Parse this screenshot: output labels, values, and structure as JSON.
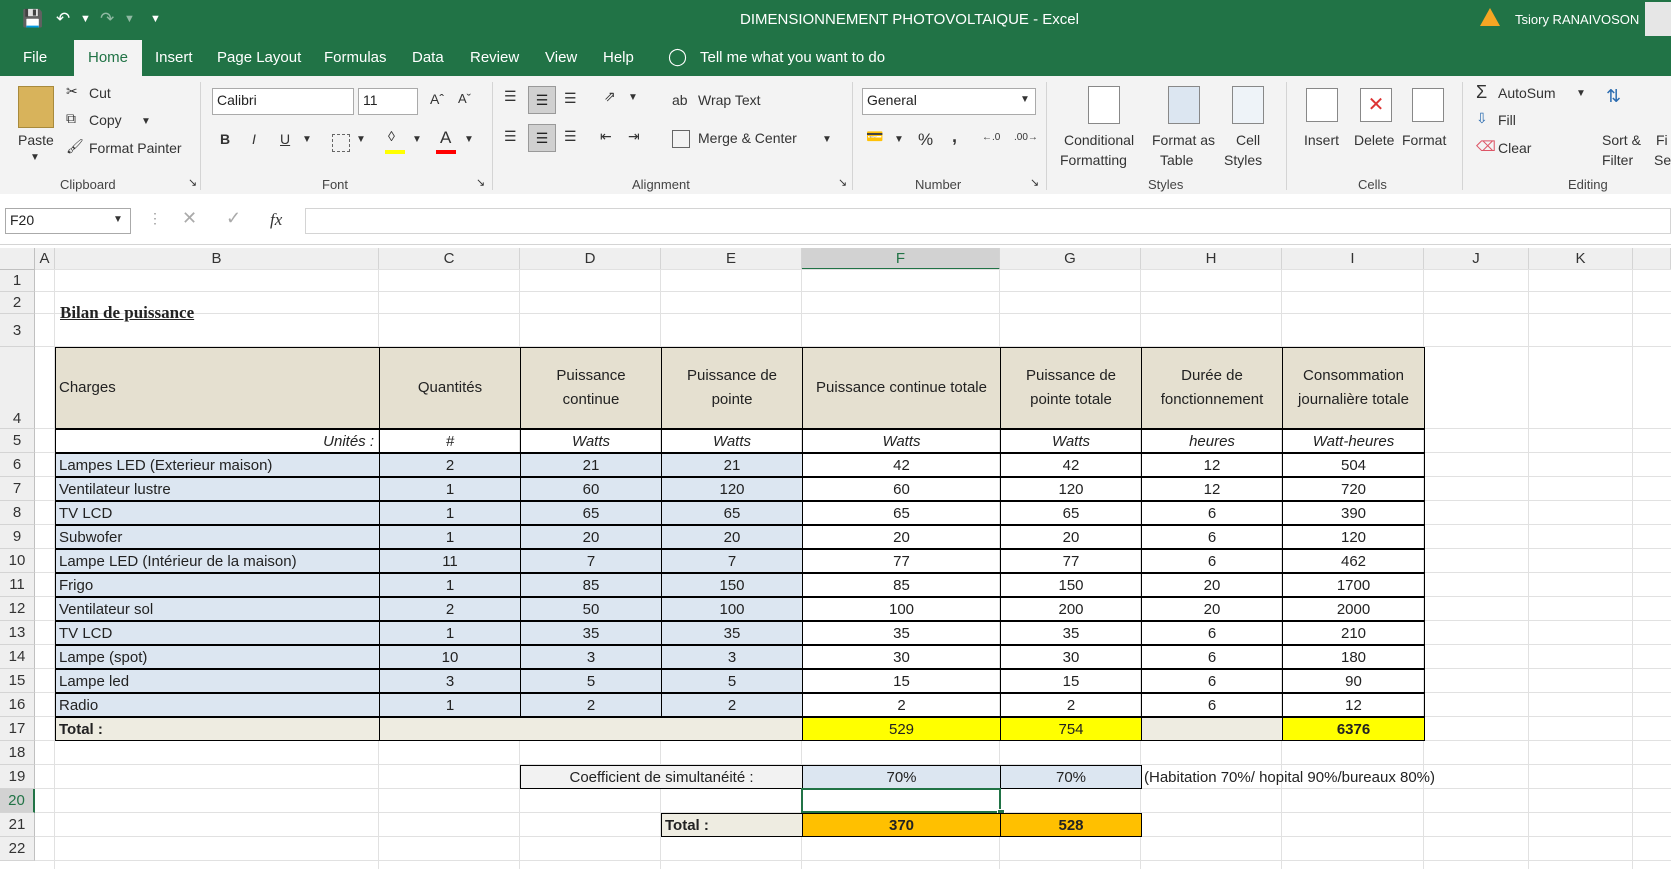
{
  "window": {
    "title": "DIMENSIONNEMENT PHOTOVOLTAIQUE  -  Excel",
    "user": "Tsiory RANAIVOSON"
  },
  "tabs": [
    "File",
    "Home",
    "Insert",
    "Page Layout",
    "Formulas",
    "Data",
    "Review",
    "View",
    "Help"
  ],
  "tell_me": "Tell me what you want to do",
  "ribbon": {
    "clipboard": {
      "paste": "Paste",
      "cut": "Cut",
      "copy": "Copy",
      "format_painter": "Format Painter",
      "label": "Clipboard"
    },
    "font": {
      "name": "Calibri",
      "size": "11",
      "label": "Font",
      "bold": "B",
      "italic": "I",
      "underline": "U"
    },
    "alignment": {
      "wrap": "Wrap Text",
      "merge": "Merge & Center",
      "label": "Alignment"
    },
    "number": {
      "format": "General",
      "label": "Number",
      "percent": "%",
      "comma": ","
    },
    "styles": {
      "conditional": "Conditional",
      "conditional2": "Formatting",
      "format_table": "Format as",
      "format_table2": "Table",
      "cell_styles": "Cell",
      "cell_styles2": "Styles",
      "label": "Styles"
    },
    "cells": {
      "insert": "Insert",
      "delete": "Delete",
      "format": "Format",
      "label": "Cells"
    },
    "editing": {
      "autosum": "AutoSum",
      "fill": "Fill",
      "clear": "Clear",
      "sort": "Sort &",
      "sort2": "Filter",
      "find": "Fi",
      "find2": "Sel",
      "label": "Editing"
    }
  },
  "formula_bar": {
    "name_box": "F20",
    "fx": "fx",
    "value": ""
  },
  "columns": [
    "A",
    "B",
    "C",
    "D",
    "E",
    "F",
    "G",
    "H",
    "I",
    "J",
    "K"
  ],
  "rows": [
    "1",
    "2",
    "3",
    "4",
    "5",
    "6",
    "7",
    "8",
    "9",
    "10",
    "11",
    "12",
    "13",
    "14",
    "15",
    "16",
    "17",
    "18",
    "19",
    "20",
    "21",
    "22"
  ],
  "sheet": {
    "title": "Bilan de puissance",
    "headers": {
      "b": "Charges",
      "c": "Quantités",
      "d": "Puissance continue",
      "e": "Puissance de pointe",
      "f": "Puissance continue totale",
      "g": "Puissance de pointe  totale",
      "h": "Durée de fonctionnement",
      "i": "Consommation journalière totale"
    },
    "units": {
      "b": "Unités :",
      "c": "#",
      "d": "Watts",
      "e": "Watts",
      "f": "Watts",
      "g": "Watts",
      "h": "heures",
      "i": "Watt-heures"
    },
    "items": [
      {
        "name": "Lampes LED (Exterieur maison)",
        "qty": "2",
        "pc": "21",
        "pp": "21",
        "pct": "42",
        "ppt": "42",
        "dur": "12",
        "cons": "504"
      },
      {
        "name": "Ventilateur lustre",
        "qty": "1",
        "pc": "60",
        "pp": "120",
        "pct": "60",
        "ppt": "120",
        "dur": "12",
        "cons": "720"
      },
      {
        "name": "TV LCD",
        "qty": "1",
        "pc": "65",
        "pp": "65",
        "pct": "65",
        "ppt": "65",
        "dur": "6",
        "cons": "390"
      },
      {
        "name": "Subwofer",
        "qty": "1",
        "pc": "20",
        "pp": "20",
        "pct": "20",
        "ppt": "20",
        "dur": "6",
        "cons": "120"
      },
      {
        "name": "Lampe LED (Intérieur de la maison)",
        "qty": "11",
        "pc": "7",
        "pp": "7",
        "pct": "77",
        "ppt": "77",
        "dur": "6",
        "cons": "462"
      },
      {
        "name": "Frigo",
        "qty": "1",
        "pc": "85",
        "pp": "150",
        "pct": "85",
        "ppt": "150",
        "dur": "20",
        "cons": "1700"
      },
      {
        "name": "Ventilateur sol",
        "qty": "2",
        "pc": "50",
        "pp": "100",
        "pct": "100",
        "ppt": "200",
        "dur": "20",
        "cons": "2000"
      },
      {
        "name": "TV LCD",
        "qty": "1",
        "pc": "35",
        "pp": "35",
        "pct": "35",
        "ppt": "35",
        "dur": "6",
        "cons": "210"
      },
      {
        "name": "Lampe (spot)",
        "qty": "10",
        "pc": "3",
        "pp": "3",
        "pct": "30",
        "ppt": "30",
        "dur": "6",
        "cons": "180"
      },
      {
        "name": "Lampe led",
        "qty": "3",
        "pc": "5",
        "pp": "5",
        "pct": "15",
        "ppt": "15",
        "dur": "6",
        "cons": "90"
      },
      {
        "name": "Radio",
        "qty": "1",
        "pc": "2",
        "pp": "2",
        "pct": "2",
        "ppt": "2",
        "dur": "6",
        "cons": "12"
      }
    ],
    "total": {
      "label": "Total :",
      "pct": "529",
      "ppt": "754",
      "cons": "6376"
    },
    "coef": {
      "label": "Coefficient de simultanéité :",
      "f": "70%",
      "g": "70%",
      "note": "(Habitation 70%/ hopital 90%/bureaux 80%)"
    },
    "total2": {
      "label": "Total :",
      "f": "370",
      "g": "528"
    }
  }
}
